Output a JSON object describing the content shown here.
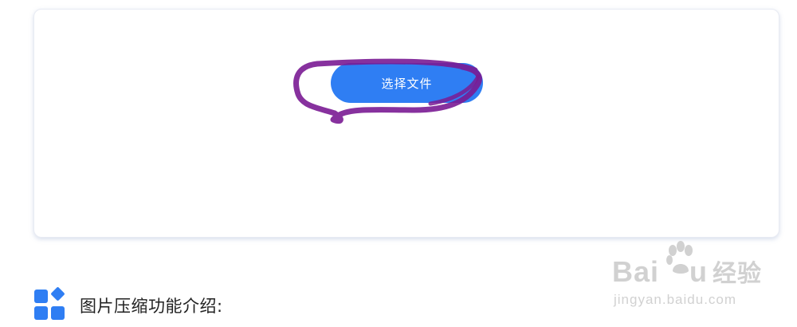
{
  "upload": {
    "button_label": "选择文件"
  },
  "feature_section": {
    "title": "图片压缩功能介绍:"
  },
  "watermark": {
    "brand_text": "Bai",
    "brand_text_end": "u",
    "brand_cn": "经验",
    "url": "jingyan.baidu.com"
  },
  "colors": {
    "accent": "#2f7ef3",
    "annotation": "#7a1b93",
    "watermark": "#cfcfcf"
  }
}
